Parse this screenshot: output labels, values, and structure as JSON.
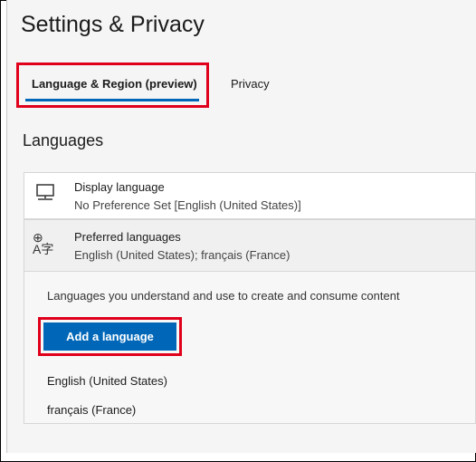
{
  "page": {
    "title": "Settings & Privacy"
  },
  "tabs": [
    {
      "label": "Language & Region (preview)",
      "active": true
    },
    {
      "label": "Privacy",
      "active": false
    }
  ],
  "section": {
    "heading": "Languages"
  },
  "display_language": {
    "icon": "monitor-icon",
    "title": "Display language",
    "value": "No Preference Set [English (United States)]"
  },
  "preferred_languages": {
    "icon": "language-icon",
    "title": "Preferred languages",
    "value": "English (United States); français (France)",
    "description": "Languages you understand and use to create and consume content",
    "add_button_label": "Add a language",
    "items": [
      "English (United States)",
      "français (France)"
    ]
  },
  "colors": {
    "accent": "#0067b8",
    "highlight": "#e0001b"
  }
}
